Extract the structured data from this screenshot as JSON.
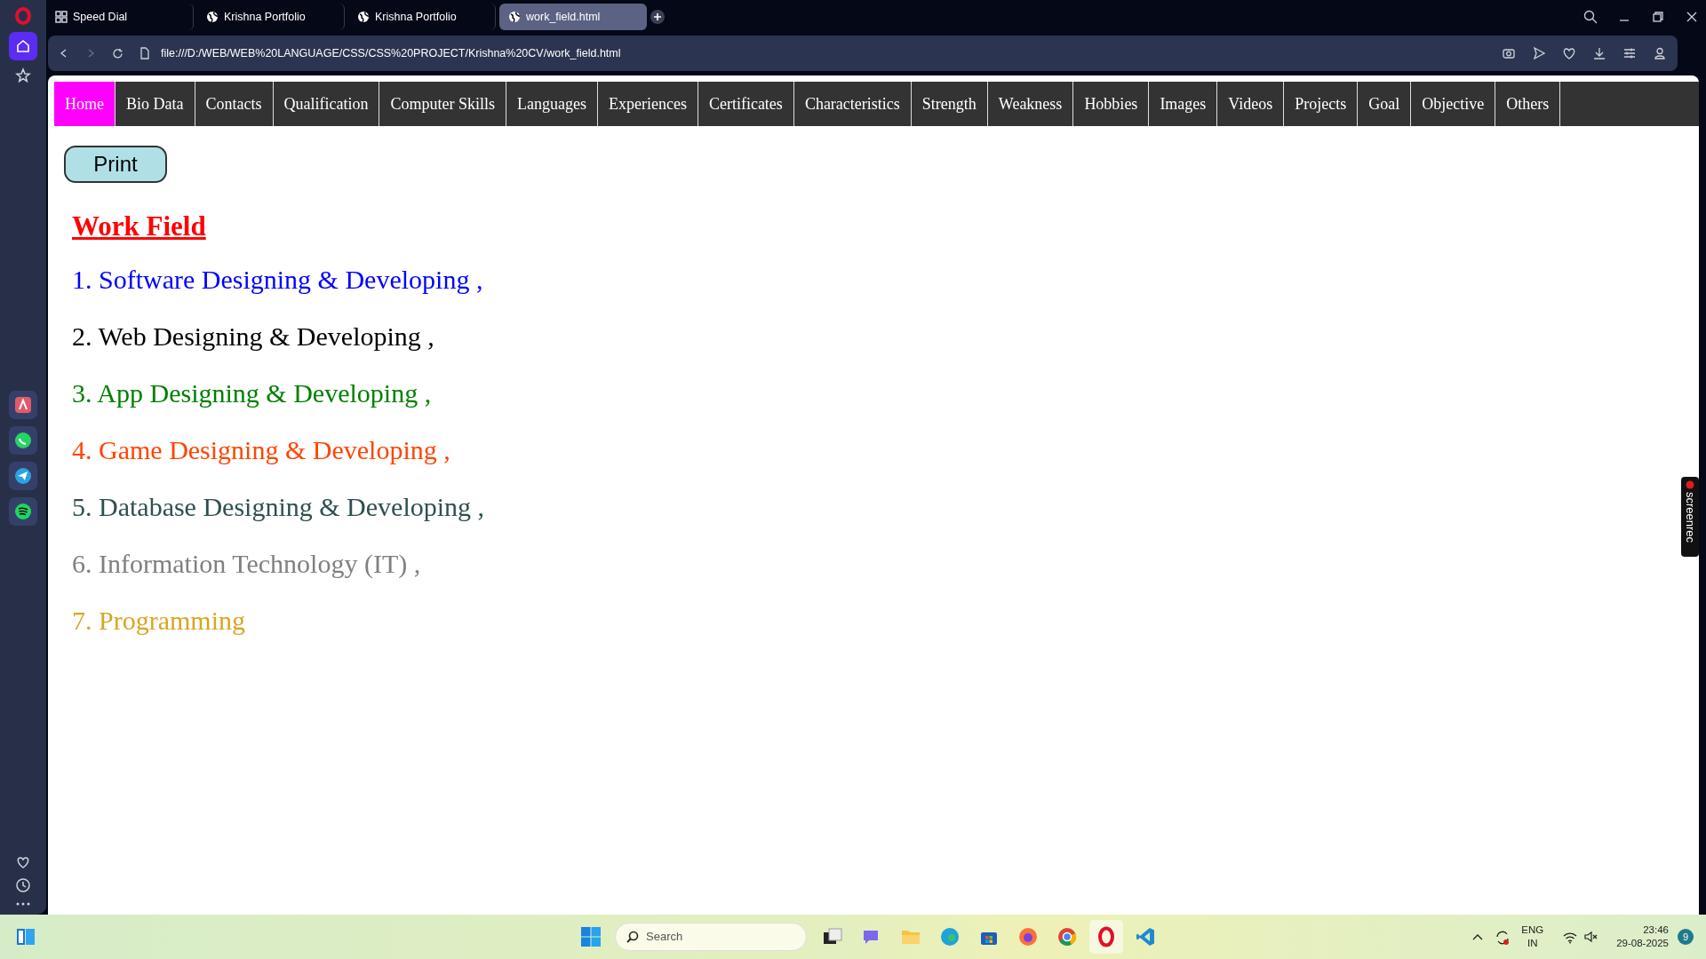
{
  "browser_tabs": [
    {
      "label": "Speed Dial",
      "kind": "grid",
      "selected": false
    },
    {
      "label": "Krishna Portfolio",
      "kind": "globe",
      "selected": false
    },
    {
      "label": "Krishna Portfolio",
      "kind": "globe",
      "selected": false
    },
    {
      "label": "work_field.html",
      "kind": "globe",
      "selected": true
    }
  ],
  "address": "file:///D:/WEB/WEB%20LANGUAGE/CSS/CSS%20PROJECT/Krishna%20CV/work_field.html",
  "nav": [
    {
      "label": "Home",
      "selected": true
    },
    {
      "label": "Bio Data",
      "selected": false
    },
    {
      "label": "Contacts",
      "selected": false
    },
    {
      "label": "Qualification",
      "selected": false
    },
    {
      "label": "Computer Skills",
      "selected": false
    },
    {
      "label": "Languages",
      "selected": false
    },
    {
      "label": "Experiences",
      "selected": false
    },
    {
      "label": "Certificates",
      "selected": false
    },
    {
      "label": "Characteristics",
      "selected": false
    },
    {
      "label": "Strength",
      "selected": false
    },
    {
      "label": "Weakness",
      "selected": false
    },
    {
      "label": "Hobbies",
      "selected": false
    },
    {
      "label": "Images",
      "selected": false
    },
    {
      "label": "Videos",
      "selected": false
    },
    {
      "label": "Projects",
      "selected": false
    },
    {
      "label": "Goal",
      "selected": false
    },
    {
      "label": "Objective",
      "selected": false
    },
    {
      "label": "Others",
      "selected": false
    }
  ],
  "print_button": "Print",
  "heading": "Work Field",
  "items": [
    {
      "text": "1. Software Designing & Developing ,",
      "color": "#0000ff"
    },
    {
      "text": "2. Web Designing & Developing ,",
      "color": "#000000"
    },
    {
      "text": "3. App Designing & Developing ,",
      "color": "#008000"
    },
    {
      "text": "4. Game Designing & Developing ,",
      "color": "#ff4500"
    },
    {
      "text": "5. Database Designing & Developing ,",
      "color": "#2f4f4f"
    },
    {
      "text": "6. Information Technology (IT) ,",
      "color": "#808080"
    },
    {
      "text": "7. Programming",
      "color": "#daa520"
    }
  ],
  "screenrec": "screenrec",
  "taskbar": {
    "search_placeholder": "Search",
    "language": "ENG",
    "region": "IN",
    "time": "23:46",
    "date": "29-08-2025",
    "notifications": "9"
  }
}
